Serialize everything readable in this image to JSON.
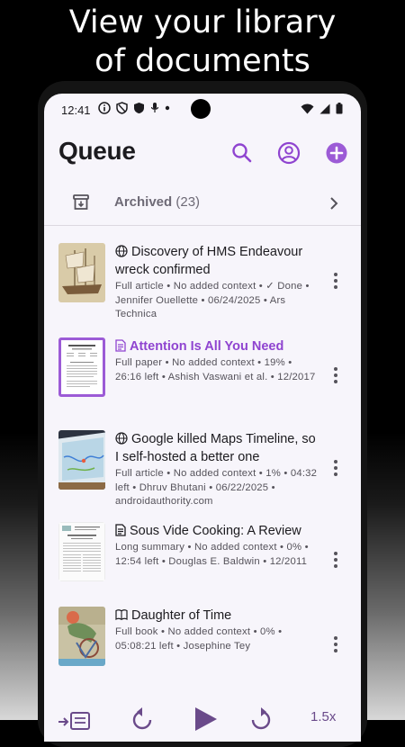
{
  "promo": {
    "line1": "View your library",
    "line2": "of documents"
  },
  "status": {
    "time": "12:41"
  },
  "appbar": {
    "title": "Queue"
  },
  "archived": {
    "label": "Archived",
    "count": "(23)"
  },
  "queue": [
    {
      "title": "Discovery of HMS Endeavour wreck confirmed",
      "meta": "Full article • No added context • ✓ Done • Jennifer Ouellette • 06/24/2025 • Ars Technica",
      "type_icon": "globe-icon",
      "active": false
    },
    {
      "title": "Attention Is All You Need",
      "meta": "Full paper • No added context • 19% • 26:16 left • Ashish Vaswani et al. • 12/2017",
      "type_icon": "document-icon",
      "active": true
    },
    {
      "title": "Google killed Maps Timeline, so I self-hosted a better one",
      "meta": "Full article • No added context • 1% • 04:32 left • Dhruv Bhutani • 06/22/2025 • androidauthority.com",
      "type_icon": "globe-icon",
      "active": false
    },
    {
      "title": "Sous Vide Cooking: A Review",
      "meta": "Long summary • No added context • 0% • 12:54 left • Douglas E. Baldwin • 12/2011",
      "type_icon": "document-icon",
      "active": false
    },
    {
      "title": "Daughter of Time",
      "meta": "Full book • No added context • 0% • 05:08:21 left • Josephine Tey",
      "type_icon": "book-icon",
      "active": false
    }
  ],
  "player": {
    "speed": "1.5x"
  },
  "colors": {
    "accent": "#8f44d0",
    "background": "#f7f5fb"
  }
}
